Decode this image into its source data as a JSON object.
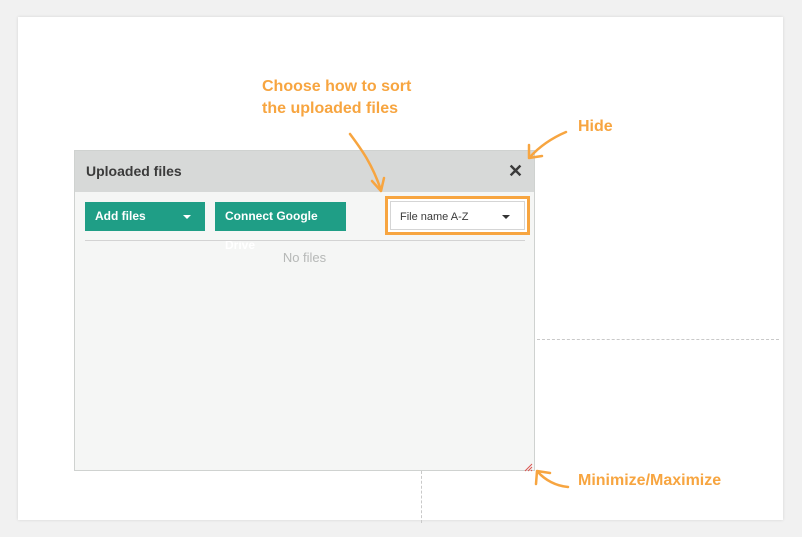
{
  "panel": {
    "title": "Uploaded files",
    "close_icon": "close-icon",
    "add_files_label": "Add files",
    "connect_drive_label": "Connect Google Drive",
    "sort_selected": "File name A-Z",
    "empty_text": "No files",
    "resize_icon": "resize-handle-icon"
  },
  "annotations": {
    "sort_line1": "Choose how to sort",
    "sort_line2": "the uploaded files",
    "hide": "Hide",
    "minmax": "Minimize/Maximize"
  },
  "colors": {
    "accent_orange": "#f7a540",
    "button_green": "#1f9e86",
    "header_gray": "#d7d9d8",
    "panel_bg": "#f5f6f5"
  }
}
